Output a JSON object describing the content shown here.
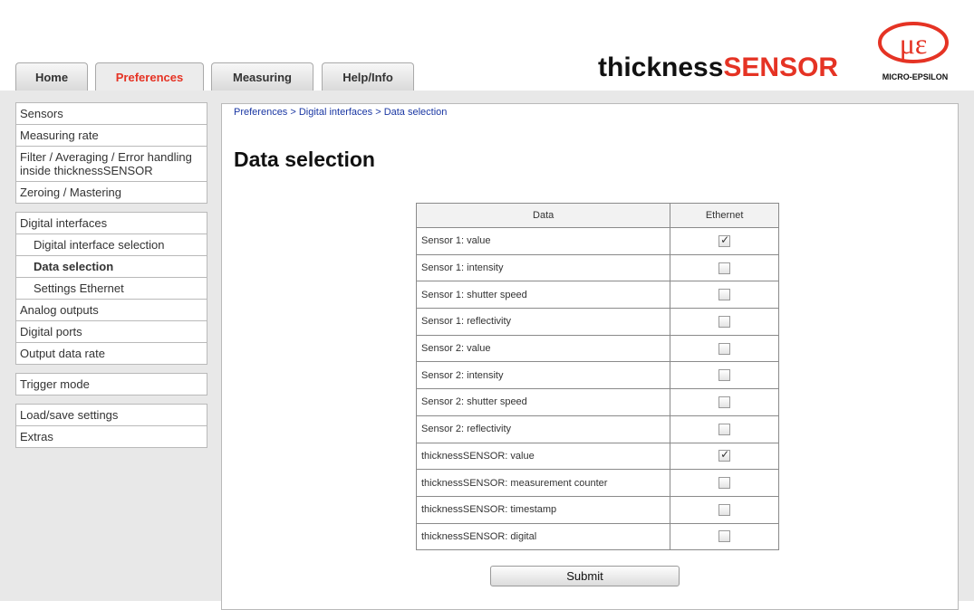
{
  "tabs": [
    {
      "label": "Home",
      "active": false
    },
    {
      "label": "Preferences",
      "active": true
    },
    {
      "label": "Measuring",
      "active": false
    },
    {
      "label": "Help/Info",
      "active": false
    }
  ],
  "logo": {
    "prefix": "thickness",
    "accent": "SENSOR",
    "brand": "MICRO-EPSILON",
    "accent_color": "#e53324"
  },
  "sidebar": {
    "group1": [
      "Sensors",
      "Measuring rate",
      "Filter / Averaging / Error handling inside thicknessSENSOR",
      "Zeroing / Mastering"
    ],
    "group2": {
      "title": "Digital interfaces",
      "subitems": [
        "Digital interface selection",
        "Data selection",
        "Settings Ethernet"
      ],
      "items": [
        "Analog outputs",
        "Digital ports",
        "Output data rate"
      ]
    },
    "group3": [
      "Trigger mode"
    ],
    "group4": [
      "Load/save settings",
      "Extras"
    ]
  },
  "breadcrumb": {
    "path": "Preferences > Digital interfaces > Data selection"
  },
  "page_title": "Data selection",
  "table": {
    "headers": [
      "Data",
      "Ethernet"
    ],
    "rows": [
      {
        "label": "Sensor 1: value",
        "checked": true
      },
      {
        "label": "Sensor 1: intensity",
        "checked": false
      },
      {
        "label": "Sensor 1: shutter speed",
        "checked": false
      },
      {
        "label": "Sensor 1: reflectivity",
        "checked": false
      },
      {
        "label": "Sensor 2: value",
        "checked": false
      },
      {
        "label": "Sensor 2: intensity",
        "checked": false
      },
      {
        "label": "Sensor 2: shutter speed",
        "checked": false
      },
      {
        "label": "Sensor 2: reflectivity",
        "checked": false
      },
      {
        "label": "thicknessSENSOR: value",
        "checked": true
      },
      {
        "label": "thicknessSENSOR: measurement counter",
        "checked": false
      },
      {
        "label": "thicknessSENSOR: timestamp",
        "checked": false
      },
      {
        "label": "thicknessSENSOR: digital",
        "checked": false
      }
    ]
  },
  "submit_label": "Submit"
}
